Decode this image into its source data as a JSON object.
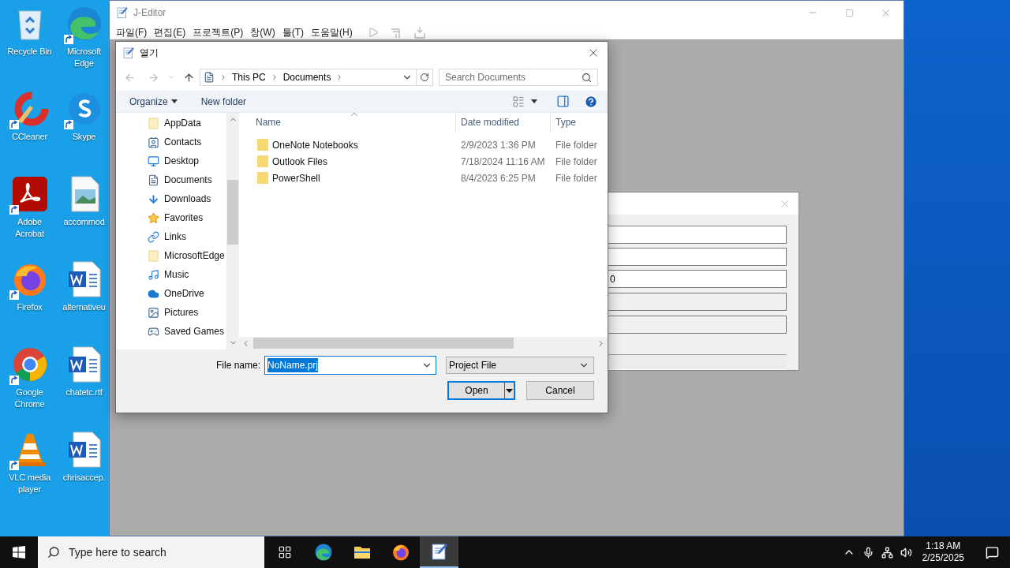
{
  "desktop_icons": [
    {
      "label": "Recycle Bin",
      "kind": "recycle",
      "shortcut": false
    },
    {
      "label": "Microsoft Edge",
      "kind": "edge",
      "shortcut": true
    },
    {
      "label": "CCleaner",
      "kind": "ccleaner",
      "shortcut": true
    },
    {
      "label": "Skype",
      "kind": "skype",
      "shortcut": true
    },
    {
      "label": "Adobe Acrobat",
      "kind": "acrobat",
      "shortcut": true
    },
    {
      "label": "accommod",
      "kind": "image",
      "shortcut": false
    },
    {
      "label": "Firefox",
      "kind": "firefox",
      "shortcut": true
    },
    {
      "label": "alternativeu",
      "kind": "word",
      "shortcut": false
    },
    {
      "label": "Google Chrome",
      "kind": "chrome",
      "shortcut": true
    },
    {
      "label": "chatetc.rtf",
      "kind": "word",
      "shortcut": false
    },
    {
      "label": "VLC media player",
      "kind": "vlc",
      "shortcut": true
    },
    {
      "label": "chrisaccep.",
      "kind": "word",
      "shortcut": false
    }
  ],
  "editor": {
    "title": "J-Editor",
    "menu": [
      "파일(F)",
      "편집(E)",
      "프로젝트(P)",
      "창(W)",
      "툴(T)",
      "도움말(H)"
    ]
  },
  "back_dialog": {
    "fields": [
      {
        "kind": "input"
      },
      {
        "kind": "input"
      },
      {
        "kind": "input",
        "value": "0"
      },
      {
        "kind": "disabled"
      },
      {
        "kind": "disabled"
      },
      {
        "kind": "bar"
      }
    ]
  },
  "open_dialog": {
    "title": "열기",
    "address": [
      "This PC",
      "Documents"
    ],
    "search": {
      "placeholder": "Search Documents"
    },
    "toolbar": [
      "Organize",
      "New folder"
    ],
    "sidebar": [
      {
        "label": "AppData",
        "kind": "folder"
      },
      {
        "label": "Contacts",
        "kind": "contacts"
      },
      {
        "label": "Desktop",
        "kind": "desktop"
      },
      {
        "label": "Documents",
        "kind": "documents"
      },
      {
        "label": "Downloads",
        "kind": "downloads"
      },
      {
        "label": "Favorites",
        "kind": "favorites"
      },
      {
        "label": "Links",
        "kind": "links"
      },
      {
        "label": "MicrosoftEdge",
        "kind": "folder"
      },
      {
        "label": "Music",
        "kind": "music"
      },
      {
        "label": "OneDrive",
        "kind": "onedrive"
      },
      {
        "label": "Pictures",
        "kind": "pictures"
      },
      {
        "label": "Saved Games",
        "kind": "games"
      }
    ],
    "columns": [
      "Name",
      "Date modified",
      "Type"
    ],
    "rows": [
      {
        "name": "OneNote Notebooks",
        "date": "2/9/2023 1:36 PM",
        "type": "File folder"
      },
      {
        "name": "Outlook Files",
        "date": "7/18/2024 11:16 AM",
        "type": "File folder"
      },
      {
        "name": "PowerShell",
        "date": "8/4/2023 6:25 PM",
        "type": "File folder"
      }
    ],
    "file_name_label": "File name:",
    "file_name": {
      "value": "NoName.prj",
      "selected": true
    },
    "filter": "Project File",
    "open_button": {
      "label": "Open",
      "default": true
    },
    "cancel_button": "Cancel"
  },
  "taskbar": {
    "search_placeholder": "Type here to search",
    "apps": [
      {
        "kind": "taskview",
        "active": false
      },
      {
        "kind": "edge",
        "active": false
      },
      {
        "kind": "explorer",
        "active": false
      },
      {
        "kind": "firefox",
        "active": false
      },
      {
        "kind": "editor",
        "active": true
      }
    ],
    "time": "1:18 AM",
    "date": "2/25/2025"
  }
}
